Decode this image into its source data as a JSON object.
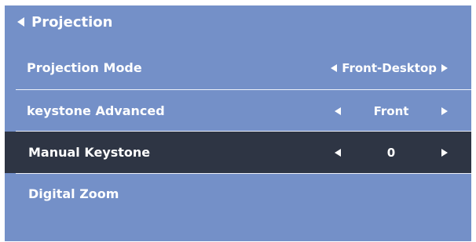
{
  "header": {
    "title": "Projection"
  },
  "rows": [
    {
      "label": "Projection Mode",
      "value": "Front-Desktop",
      "selected": false
    },
    {
      "label": "keystone Advanced",
      "value": "Front",
      "selected": false
    },
    {
      "label": "Manual Keystone",
      "value": "0",
      "selected": true
    },
    {
      "label": "Digital Zoom",
      "value": "",
      "selected": false
    }
  ],
  "colors": {
    "panel_background": "#7490c8",
    "selected_row_background": "#2e3544",
    "text": "#ffffff"
  }
}
